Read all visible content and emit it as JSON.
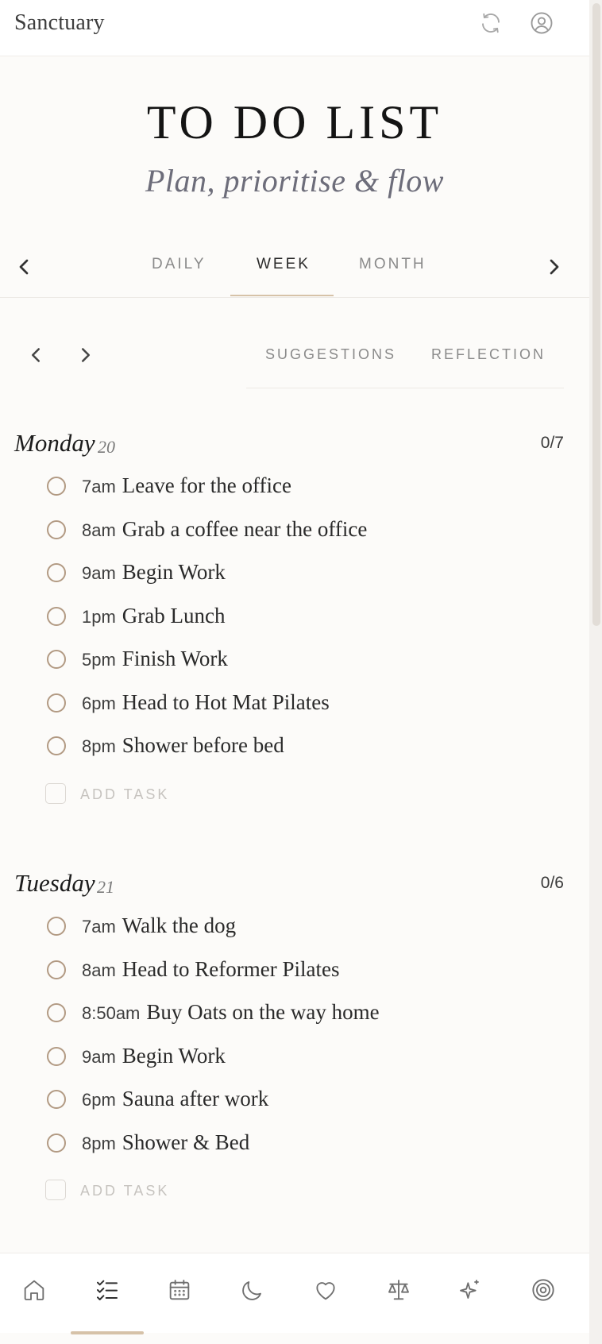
{
  "app": {
    "brand": "Sanctuary"
  },
  "page": {
    "title": "TO DO LIST",
    "subtitle": "Plan, prioritise & flow"
  },
  "period_tabs": [
    {
      "label": "DAILY",
      "active": false
    },
    {
      "label": "WEEK",
      "active": true
    },
    {
      "label": "MONTH",
      "active": false
    }
  ],
  "sub_tabs": [
    {
      "label": "SUGGESTIONS"
    },
    {
      "label": "REFLECTION"
    }
  ],
  "days": [
    {
      "name": "Monday",
      "date": "20",
      "count": "0/7",
      "tasks": [
        {
          "time": "7am",
          "text": "Leave for the office"
        },
        {
          "time": "8am",
          "text": "Grab a coffee near the office"
        },
        {
          "time": "9am",
          "text": "Begin Work"
        },
        {
          "time": "1pm",
          "text": "Grab Lunch"
        },
        {
          "time": "5pm",
          "text": "Finish Work"
        },
        {
          "time": "6pm",
          "text": "Head to Hot Mat Pilates"
        },
        {
          "time": "8pm",
          "text": "Shower before bed"
        }
      ],
      "add_label": "ADD TASK"
    },
    {
      "name": "Tuesday",
      "date": "21",
      "count": "0/6",
      "tasks": [
        {
          "time": "7am",
          "text": "Walk the dog"
        },
        {
          "time": "8am",
          "text": "Head to Reformer Pilates"
        },
        {
          "time": "8:50am",
          "text": "Buy Oats on the way home"
        },
        {
          "time": "9am",
          "text": "Begin Work"
        },
        {
          "time": "6pm",
          "text": "Sauna after work"
        },
        {
          "time": "8pm",
          "text": "Shower & Bed"
        }
      ],
      "add_label": "ADD TASK"
    }
  ],
  "bottom_nav": [
    {
      "icon": "home-icon",
      "active": false
    },
    {
      "icon": "checklist-icon",
      "active": true
    },
    {
      "icon": "calendar-icon",
      "active": false
    },
    {
      "icon": "moon-icon",
      "active": false
    },
    {
      "icon": "heart-icon",
      "active": false
    },
    {
      "icon": "scale-icon",
      "active": false
    },
    {
      "icon": "sparkle-icon",
      "active": false
    },
    {
      "icon": "target-icon",
      "active": false
    }
  ],
  "colors": {
    "accent": "#d6c2a8",
    "circle": "#b29a83",
    "background": "#fcfbf9"
  }
}
